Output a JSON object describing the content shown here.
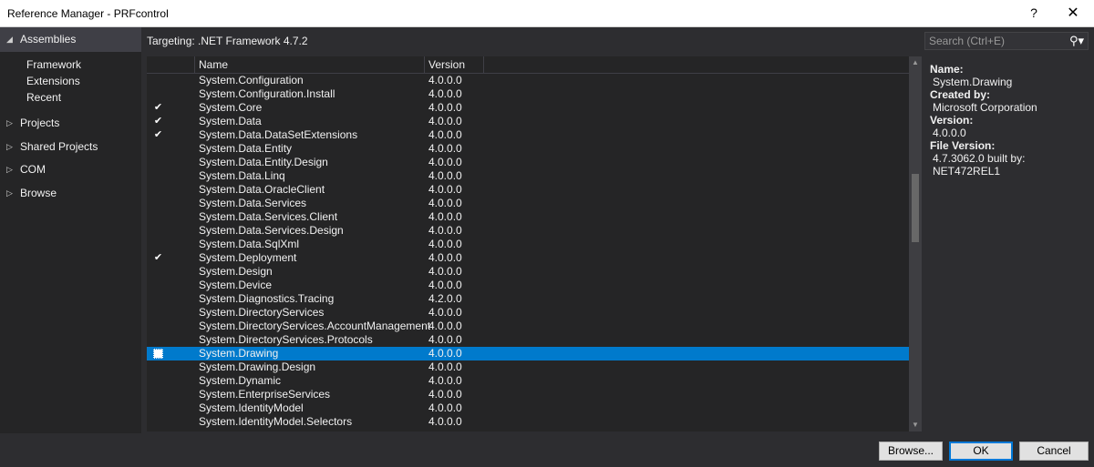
{
  "window": {
    "title": "Reference Manager - PRFcontrol",
    "help_label": "?",
    "close_label": "✕"
  },
  "sidebar": {
    "assemblies": {
      "arrow": "◢",
      "label": "Assemblies"
    },
    "assemblies_children": [
      "Framework",
      "Extensions",
      "Recent"
    ],
    "groups": [
      {
        "arrow": "▷",
        "label": "Projects"
      },
      {
        "arrow": "▷",
        "label": "Shared Projects"
      },
      {
        "arrow": "▷",
        "label": "COM"
      },
      {
        "arrow": "▷",
        "label": "Browse"
      }
    ]
  },
  "targeting": "Targeting: .NET Framework 4.7.2",
  "search": {
    "placeholder": "Search (Ctrl+E)",
    "icon": "search-icon",
    "icon_glyph": "⚲▾"
  },
  "grid": {
    "columns": {
      "name": "Name",
      "version": "Version"
    },
    "rows": [
      {
        "name": "System.Configuration",
        "version": "4.0.0.0",
        "checked": false
      },
      {
        "name": "System.Configuration.Install",
        "version": "4.0.0.0",
        "checked": false
      },
      {
        "name": "System.Core",
        "version": "4.0.0.0",
        "checked": true
      },
      {
        "name": "System.Data",
        "version": "4.0.0.0",
        "checked": true
      },
      {
        "name": "System.Data.DataSetExtensions",
        "version": "4.0.0.0",
        "checked": true
      },
      {
        "name": "System.Data.Entity",
        "version": "4.0.0.0",
        "checked": false
      },
      {
        "name": "System.Data.Entity.Design",
        "version": "4.0.0.0",
        "checked": false
      },
      {
        "name": "System.Data.Linq",
        "version": "4.0.0.0",
        "checked": false
      },
      {
        "name": "System.Data.OracleClient",
        "version": "4.0.0.0",
        "checked": false
      },
      {
        "name": "System.Data.Services",
        "version": "4.0.0.0",
        "checked": false
      },
      {
        "name": "System.Data.Services.Client",
        "version": "4.0.0.0",
        "checked": false
      },
      {
        "name": "System.Data.Services.Design",
        "version": "4.0.0.0",
        "checked": false
      },
      {
        "name": "System.Data.SqlXml",
        "version": "4.0.0.0",
        "checked": false
      },
      {
        "name": "System.Deployment",
        "version": "4.0.0.0",
        "checked": true
      },
      {
        "name": "System.Design",
        "version": "4.0.0.0",
        "checked": false
      },
      {
        "name": "System.Device",
        "version": "4.0.0.0",
        "checked": false
      },
      {
        "name": "System.Diagnostics.Tracing",
        "version": "4.2.0.0",
        "checked": false
      },
      {
        "name": "System.DirectoryServices",
        "version": "4.0.0.0",
        "checked": false
      },
      {
        "name": "System.DirectoryServices.AccountManagement",
        "version": "4.0.0.0",
        "checked": false
      },
      {
        "name": "System.DirectoryServices.Protocols",
        "version": "4.0.0.0",
        "checked": false
      },
      {
        "name": "System.Drawing",
        "version": "4.0.0.0",
        "checked": false,
        "selected": true
      },
      {
        "name": "System.Drawing.Design",
        "version": "4.0.0.0",
        "checked": false
      },
      {
        "name": "System.Dynamic",
        "version": "4.0.0.0",
        "checked": false
      },
      {
        "name": "System.EnterpriseServices",
        "version": "4.0.0.0",
        "checked": false
      },
      {
        "name": "System.IdentityModel",
        "version": "4.0.0.0",
        "checked": false
      },
      {
        "name": "System.IdentityModel.Selectors",
        "version": "4.0.0.0",
        "checked": false
      }
    ]
  },
  "details": {
    "name_label": "Name:",
    "name_value": "System.Drawing",
    "created_label": "Created by:",
    "created_value": "Microsoft Corporation",
    "version_label": "Version:",
    "version_value": "4.0.0.0",
    "file_version_label": "File Version:",
    "file_version_value": "4.7.3062.0 built by: NET472REL1"
  },
  "buttons": {
    "browse": "Browse...",
    "ok": "OK",
    "cancel": "Cancel"
  },
  "colors": {
    "selection": "#007acc",
    "background": "#2d2d30",
    "panel": "#252526"
  }
}
